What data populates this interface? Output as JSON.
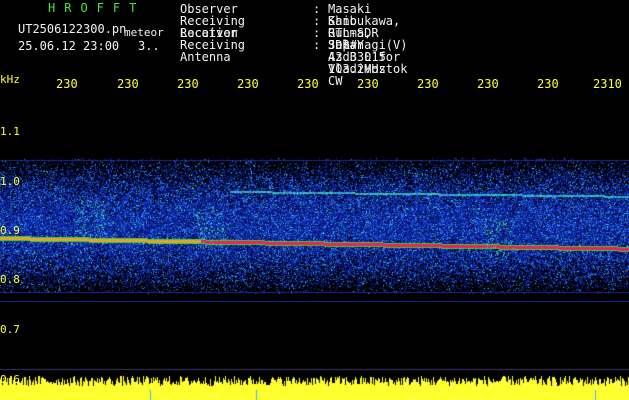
{
  "logo": "HROFFT",
  "filename": "UT2506122300.pn",
  "tag": "meteor",
  "datetime": "25.06.12 23:00",
  "count": "3..",
  "headers": [
    {
      "key": "Observer",
      "value": "Masaki Kano"
    },
    {
      "key": "Receiving Location",
      "value": "Shibukawa, Gunma, Japan"
    },
    {
      "key": "Receiver",
      "value": "RTL-SDR SDR# 43dB L15 103.2MHz CW"
    },
    {
      "key": "Receiving Antenna",
      "value": "3el Yagi(V) Az 330 for Vladivostok"
    }
  ],
  "axis_unit": "kHz",
  "time_ticks": [
    "230",
    "230",
    "230",
    "230",
    "230",
    "230",
    "230",
    "230",
    "230",
    "2310"
  ],
  "freq_ticks": [
    "1.1",
    "1.0",
    "0.9",
    "0.8",
    "0.7",
    "0.6"
  ],
  "colors": {
    "text": "#f2f2f2",
    "axis": "#ffff3a",
    "logo": "#3ee83e",
    "background": "#000000"
  }
}
